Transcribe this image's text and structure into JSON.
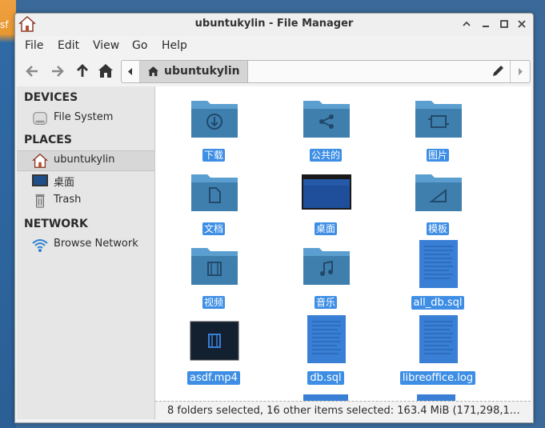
{
  "desktop": {
    "peek_label": "sf"
  },
  "window": {
    "title": "ubuntukylin - File Manager"
  },
  "menubar": {
    "items": [
      "File",
      "Edit",
      "View",
      "Go",
      "Help"
    ]
  },
  "pathbar": {
    "crumb": "ubuntukylin"
  },
  "sidebar": {
    "devices_heading": "DEVICES",
    "places_heading": "PLACES",
    "network_heading": "NETWORK",
    "items": [
      {
        "label": "File System",
        "icon": "drive-icon"
      },
      {
        "label": "ubuntukylin",
        "icon": "home-folder-icon",
        "selected": true
      },
      {
        "label": "桌面",
        "icon": "desktop-icon"
      },
      {
        "label": "Trash",
        "icon": "trash-icon"
      },
      {
        "label": "Browse Network",
        "icon": "network-icon"
      }
    ]
  },
  "files": [
    {
      "label": "下载",
      "icon": "download-folder-icon"
    },
    {
      "label": "公共的",
      "icon": "share-folder-icon"
    },
    {
      "label": "图片",
      "icon": "pictures-folder-icon"
    },
    {
      "label": "文档",
      "icon": "documents-folder-icon"
    },
    {
      "label": "桌面",
      "icon": "desktop-folder-icon"
    },
    {
      "label": "模板",
      "icon": "templates-folder-icon"
    },
    {
      "label": "视频",
      "icon": "videos-folder-icon"
    },
    {
      "label": "音乐",
      "icon": "music-folder-icon"
    },
    {
      "label": "all_db.sql",
      "icon": "text-file-icon"
    },
    {
      "label": "asdf.mp4",
      "icon": "video-file-icon"
    },
    {
      "label": "db.sql",
      "icon": "text-file-icon"
    },
    {
      "label": "libreoffice.log",
      "icon": "text-file-icon"
    }
  ],
  "status": {
    "text": "8 folders selected, 16 other items selected: 163.4 MiB (171,298,1…"
  },
  "colors": {
    "selection": "#3d8ee4",
    "folder": "#3f7fad",
    "folder_tab": "#5b9fd0"
  }
}
